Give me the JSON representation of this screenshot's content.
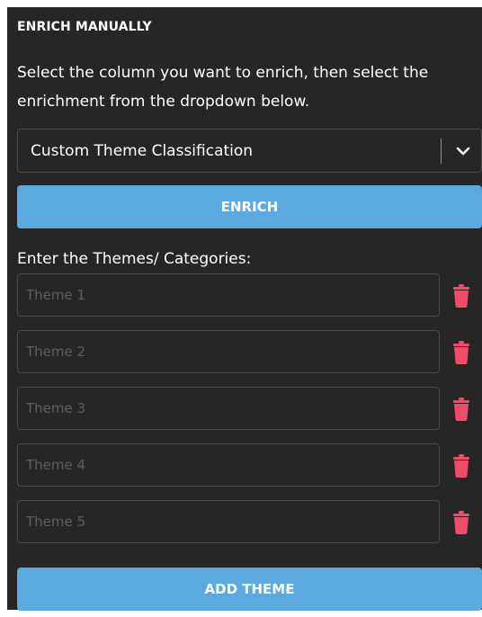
{
  "panel": {
    "title": "ENRICH MANUALLY",
    "instructions": "Select the column you want to enrich, then select the enrichment from the dropdown below."
  },
  "dropdown": {
    "selected": "Custom Theme Classification",
    "icon": "chevron-down-icon"
  },
  "buttons": {
    "enrich": "ENRICH",
    "add_theme": "ADD THEME"
  },
  "themes": {
    "label": "Enter the Themes/ Categories:",
    "items": [
      {
        "placeholder": "Theme 1",
        "value": ""
      },
      {
        "placeholder": "Theme 2",
        "value": ""
      },
      {
        "placeholder": "Theme 3",
        "value": ""
      },
      {
        "placeholder": "Theme 4",
        "value": ""
      },
      {
        "placeholder": "Theme 5",
        "value": ""
      }
    ],
    "delete_icon": "trash-icon"
  },
  "colors": {
    "background": "#262626",
    "accent": "#5aa9df",
    "delete": "#f04b6a",
    "border": "#4a4a4a"
  }
}
